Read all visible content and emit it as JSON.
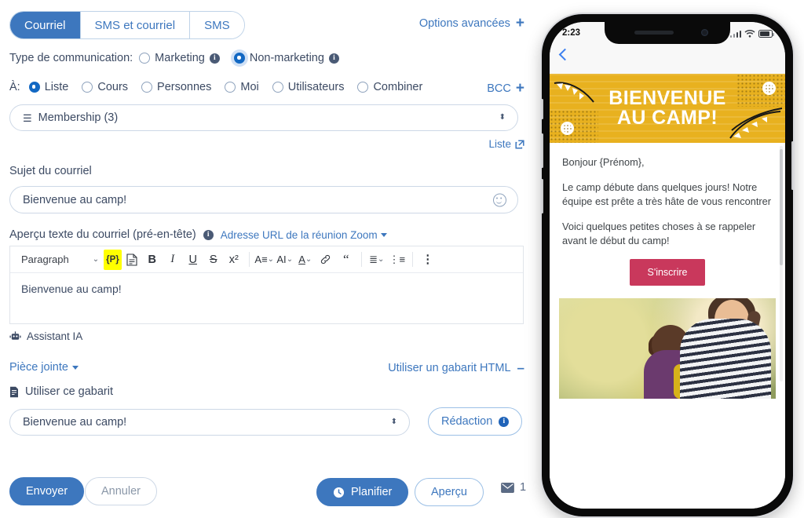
{
  "tabs": [
    {
      "label": "Courriel",
      "active": true
    },
    {
      "label": "SMS et courriel",
      "active": false
    },
    {
      "label": "SMS",
      "active": false
    }
  ],
  "advanced_options": {
    "label": "Options avancées",
    "icon": "plus-icon"
  },
  "communication_type": {
    "label": "Type de communication:",
    "options": [
      {
        "label": "Marketing",
        "selected": false,
        "info": true
      },
      {
        "label": "Non-marketing",
        "selected": true,
        "info": true
      }
    ]
  },
  "recipients": {
    "label": "À:",
    "options": [
      {
        "label": "Liste",
        "selected": true
      },
      {
        "label": "Cours",
        "selected": false
      },
      {
        "label": "Personnes",
        "selected": false
      },
      {
        "label": "Moi",
        "selected": false
      },
      {
        "label": "Utilisateurs",
        "selected": false
      },
      {
        "label": "Combiner",
        "selected": false
      }
    ],
    "bcc_label": "BCC"
  },
  "list_select": {
    "value": "Membership (3)",
    "icon": "list-icon"
  },
  "list_link": {
    "label": "Liste",
    "icon": "external-link-icon"
  },
  "subject": {
    "label": "Sujet du courriel",
    "value": "Bienvenue au camp!",
    "emoji_icon": "emoji-smiley-icon"
  },
  "preheader": {
    "label": "Aperçu texte du courriel (pré-en-tête)",
    "zoom_link": "Adresse URL de la réunion Zoom"
  },
  "editor": {
    "paragraph_style": "Paragraph",
    "toolbar": [
      {
        "name": "placeholder-token-button",
        "glyph": "{P}"
      },
      {
        "name": "document-icon-button",
        "glyph": "▤"
      },
      {
        "name": "bold-button",
        "glyph": "B"
      },
      {
        "name": "italic-button",
        "glyph": "I"
      },
      {
        "name": "underline-button",
        "glyph": "U"
      },
      {
        "name": "strikethrough-button",
        "glyph": "S"
      },
      {
        "name": "superscript-button",
        "glyph": "x²"
      },
      {
        "name": "font-family-button",
        "glyph": "A"
      },
      {
        "name": "font-size-button",
        "glyph": "AI"
      },
      {
        "name": "text-color-button",
        "glyph": "A"
      },
      {
        "name": "link-button",
        "glyph": "🔗"
      },
      {
        "name": "blockquote-button",
        "glyph": "❝"
      },
      {
        "name": "align-button",
        "glyph": "≡"
      },
      {
        "name": "bullet-list-button",
        "glyph": "☰"
      },
      {
        "name": "more-options-button",
        "glyph": "⋮"
      }
    ],
    "content": "Bienvenue au camp!"
  },
  "ai_assistant": {
    "label": "Assistant IA",
    "icon": "robot-icon"
  },
  "attachment": {
    "label": "Pièce jointe",
    "icon": "caret-down-icon"
  },
  "html_template_toggle": {
    "label": "Utiliser un gabarit HTML",
    "icon": "minus-icon"
  },
  "use_template": {
    "label": "Utiliser ce gabarit",
    "icon": "file-icon"
  },
  "template_select": {
    "value": "Bienvenue au camp!"
  },
  "redaction_button": {
    "label": "Rédaction",
    "info": true
  },
  "actions": {
    "send": "Envoyer",
    "cancel": "Annuler",
    "schedule": "Planifier",
    "schedule_icon": "clock-icon",
    "preview": "Aperçu",
    "mail_count": "1",
    "mail_icon": "envelope-icon"
  },
  "phone_preview": {
    "status_bar": {
      "time": "2:23",
      "signal_icon": "signal-bars-icon",
      "wifi_icon": "wifi-icon",
      "battery_icon": "battery-icon"
    },
    "back_icon": "back-chevron-icon",
    "banner": {
      "line1": "BIENVENUE",
      "line2": "AU CAMP!",
      "background": "#e8b11f"
    },
    "body": [
      "Bonjour {Prénom},",
      "Le camp débute dans quelques jours! Notre équipe est prête a très hâte de vous rencontrer",
      "Voici quelques petites choses à se rappeler avant le début du camp!"
    ],
    "cta": {
      "label": "S'inscrire",
      "color": "#c9385c"
    },
    "photo_alt": "Femme en chandail rayé marchant avec un enfant en plein air"
  },
  "colors": {
    "accent": "#3d77be",
    "link": "#3d77be",
    "radio": "#1268c3",
    "banner": "#e8b11f",
    "cta": "#c9385c"
  }
}
